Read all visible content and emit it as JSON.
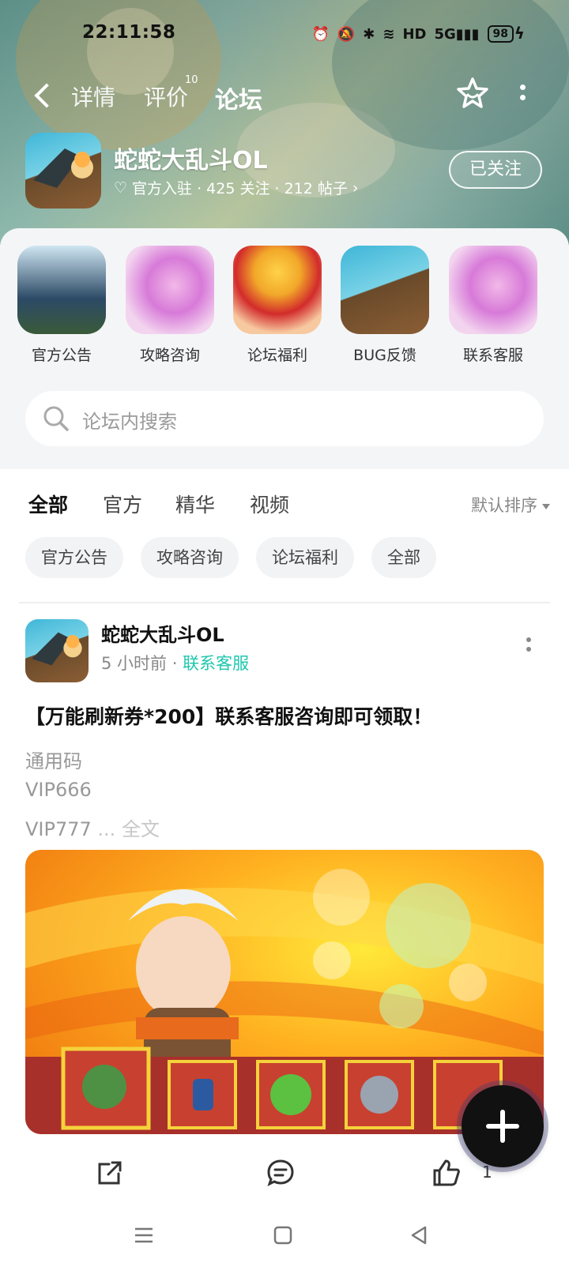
{
  "status_bar": {
    "time": "22:11:58",
    "network": "5G",
    "hd_label": "HD",
    "battery": "98"
  },
  "nav": {
    "tabs": [
      {
        "label": "详情"
      },
      {
        "label": "评价",
        "badge": "10"
      },
      {
        "label": "论坛",
        "active": true
      }
    ]
  },
  "app": {
    "name": "蛇蛇大乱斗OL",
    "meta": "官方入驻 · 425 关注 · 212 帖子",
    "follow_label": "已关注"
  },
  "categories": [
    {
      "label": "官方公告"
    },
    {
      "label": "攻略咨询"
    },
    {
      "label": "论坛福利"
    },
    {
      "label": "BUG反馈"
    },
    {
      "label": "联系客服"
    }
  ],
  "search": {
    "placeholder": "论坛内搜索"
  },
  "feed_tabs": [
    {
      "label": "全部",
      "active": true
    },
    {
      "label": "官方"
    },
    {
      "label": "精华"
    },
    {
      "label": "视频"
    }
  ],
  "sort_label": "默认排序",
  "chips": [
    "官方公告",
    "攻略咨询",
    "论坛福利",
    "全部"
  ],
  "post": {
    "author": "蛇蛇大乱斗OL",
    "time": "5 小时前",
    "separator": "·",
    "board": "联系客服",
    "title": "【万能刷新券*200】联系客服咨询即可领取！",
    "lines": [
      "通用码",
      "VIP666",
      "VIP777"
    ],
    "ellipsis": "...",
    "more_label": "全文",
    "like_count": "1"
  },
  "colors": {
    "accent": "#1ec7ae",
    "fab": "#111111"
  }
}
